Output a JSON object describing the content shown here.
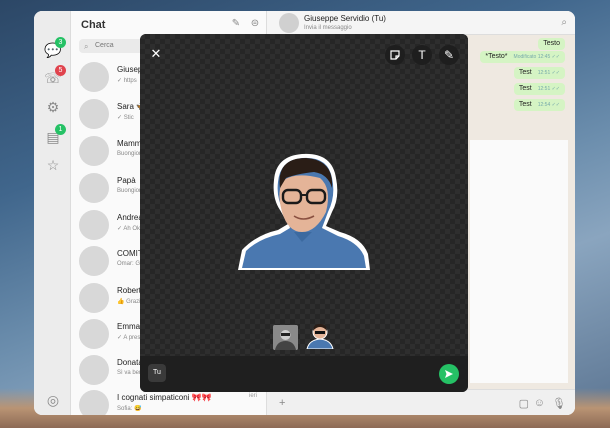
{
  "sidebar": {
    "title": "Chat",
    "search_placeholder": "Cerca",
    "rail_badges": [
      "3",
      "5",
      "1"
    ],
    "chats": [
      {
        "name": "Giusepp",
        "snippet": "✓ https",
        "time": ""
      },
      {
        "name": "Sara 🦋",
        "snippet": "✓ Stic",
        "time": ""
      },
      {
        "name": "Mamma",
        "snippet": "Buongior",
        "time": ""
      },
      {
        "name": "Papà",
        "snippet": "Buongior",
        "time": ""
      },
      {
        "name": "Andrea",
        "snippet": "✓ Ah Ok",
        "time": ""
      },
      {
        "name": "COMITAT",
        "snippet": "Omar: Gra",
        "time": ""
      },
      {
        "name": "Roberto",
        "snippet": "👍 Grazie",
        "time": ""
      },
      {
        "name": "Emmanu",
        "snippet": "✓ A prest",
        "time": ""
      },
      {
        "name": "Donata L",
        "snippet": "Sì va ben",
        "time": ""
      },
      {
        "name": "I cognati simpaticoni 🎀🎀",
        "snippet": "Sofia: 😅",
        "time": "ieri"
      }
    ]
  },
  "chat_header": {
    "name": "Giuseppe Servidio (Tu)",
    "subtitle": "Invia il messaggio"
  },
  "messages": [
    {
      "text": "Testo",
      "meta": ""
    },
    {
      "text": "*Testo*",
      "meta": "Modificato 12:45 ✓✓"
    },
    {
      "text": "Test",
      "meta": "12:51 ✓✓"
    },
    {
      "text": "Test",
      "meta": "12:51 ✓✓"
    },
    {
      "text": "Test",
      "meta": "12:54 ✓✓"
    }
  ],
  "editor": {
    "close_label": "✕",
    "tools": [
      "sticker-icon",
      "text-icon",
      "pen-icon"
    ],
    "text_tool_label": "T",
    "recipient_chip": "Tu",
    "colors": {
      "send": "#25c165",
      "shirt": "#4a78b0"
    }
  }
}
